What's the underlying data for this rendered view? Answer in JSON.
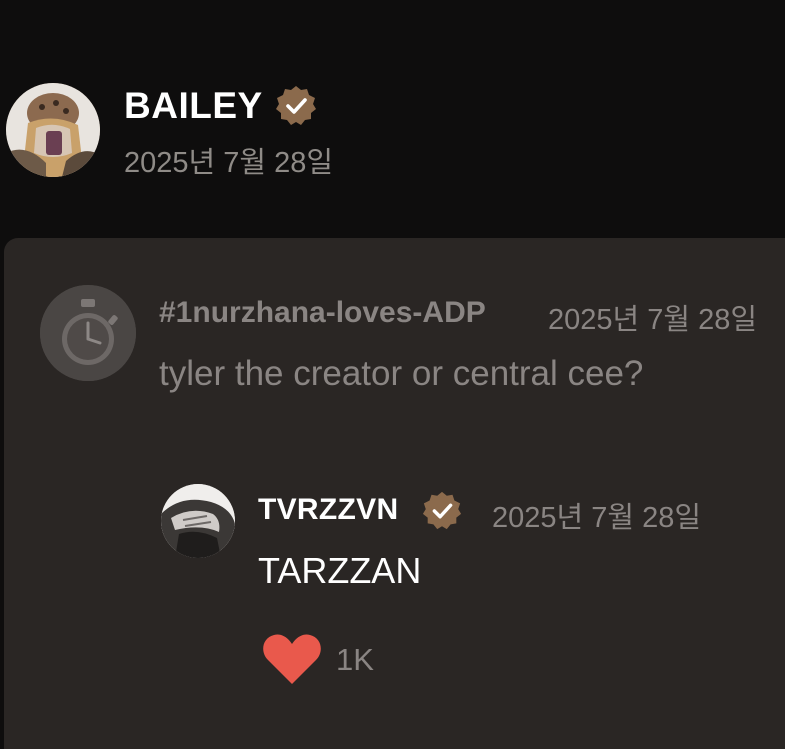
{
  "post": {
    "author": "BAILEY",
    "date": "2025년 7월 28일",
    "verified_icon": "verified-badge-icon"
  },
  "comment": {
    "username": "#1nurzhana-loves-ADP",
    "date": "2025년 7월 28일",
    "text": "tyler the creator or central cee?",
    "avatar_icon": "stopwatch-icon"
  },
  "reply": {
    "username": "TVRZZVN",
    "date": "2025년 7월 28일",
    "text": "TARZZAN",
    "like_icon": "heart-icon",
    "like_count": "1K"
  },
  "colors": {
    "background": "#0e0d0d",
    "card": "#2a2624",
    "badge": "#8b6a4c",
    "heart": "#e9594c",
    "muted_text": "#8a8583"
  }
}
